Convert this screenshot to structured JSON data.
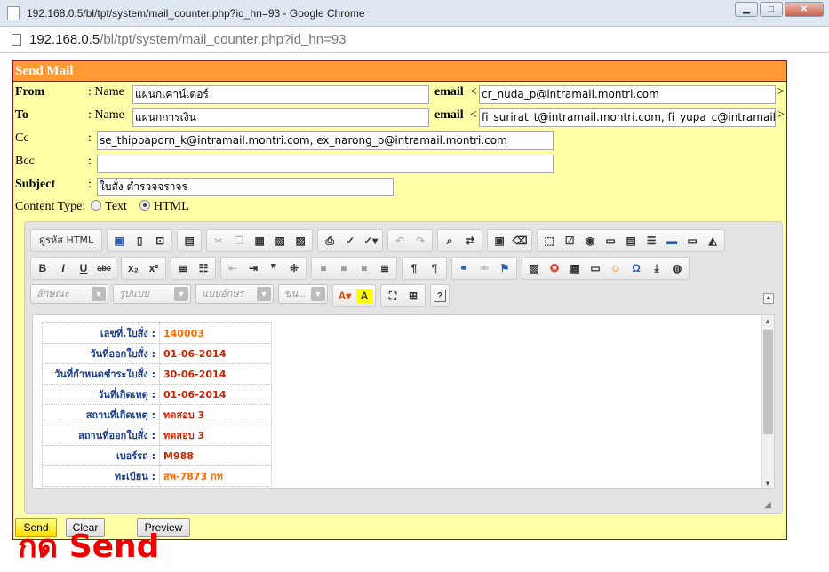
{
  "window": {
    "title": "192.168.0.5/bl/tpt/system/mail_counter.php?id_hn=93 - Google Chrome",
    "minimize": "▁",
    "maximize": "□",
    "close": "✕"
  },
  "address": {
    "host": "192.168.0.5",
    "path": "/bl/tpt/system/mail_counter.php?id_hn=93"
  },
  "form": {
    "header": "Send Mail",
    "from_label": "From",
    "to_label": "To",
    "cc_label": "Cc",
    "bcc_label": "Bcc",
    "subject_label": "Subject",
    "colon": ":",
    "name_label": ": Name",
    "email_label": "email",
    "lt": "<",
    "gt": ">",
    "from_name": "แผนกเคาน์เตอร์",
    "from_email": "cr_nuda_p@intramail.montri.com",
    "to_name": "แผนกการเงิน",
    "to_email": "fi_surirat_t@intramail.montri.com, fi_yupa_c@intramail.montri.com",
    "cc_value": "se_thippaporn_k@intramail.montri.com, ex_narong_p@intramail.montri.com",
    "bcc_value": "",
    "subject_value": "ใบสั่ง ตำรวจจราจร",
    "content_type_label": "Content Type:",
    "content_type_options": [
      "Text",
      "HTML"
    ],
    "content_type_selected": "HTML"
  },
  "editor": {
    "source_button": "ดูรหัส HTML",
    "combos": [
      "ลักษณะ",
      "รูปแบบ",
      "แบบอักษร",
      "ขน..."
    ],
    "rows": [
      {
        "label": "เลขที่.ใบสั่ง :",
        "value": "140003",
        "color": "orange"
      },
      {
        "label": "วันที่ออกใบสั่ง :",
        "value": "01-06-2014",
        "color": "red"
      },
      {
        "label": "วันที่กำหนดชำระใบสั่ง :",
        "value": "30-06-2014",
        "color": "red"
      },
      {
        "label": "วันที่เกิดเหตุ :",
        "value": "01-06-2014",
        "color": "red"
      },
      {
        "label": "สถานที่เกิดเหตุ :",
        "value": "ทดสอบ 3",
        "color": "red"
      },
      {
        "label": "สถานที่ออกใบสั่ง :",
        "value": "ทดสอบ 3",
        "color": "red"
      },
      {
        "label": "เบอร์รถ :",
        "value": "M988",
        "color": "red"
      },
      {
        "label": "ทะเบียน :",
        "value": "สพ-7873 กท",
        "color": "orange"
      }
    ]
  },
  "buttons": {
    "send": "Send",
    "clear": "Clear",
    "preview": "Preview"
  },
  "annotation": "กด Send",
  "colors": {
    "header_bg": "#ff9933",
    "form_bg": "#ffffa8",
    "send_button": "#ffdd00",
    "annotation": "#ee0000"
  }
}
